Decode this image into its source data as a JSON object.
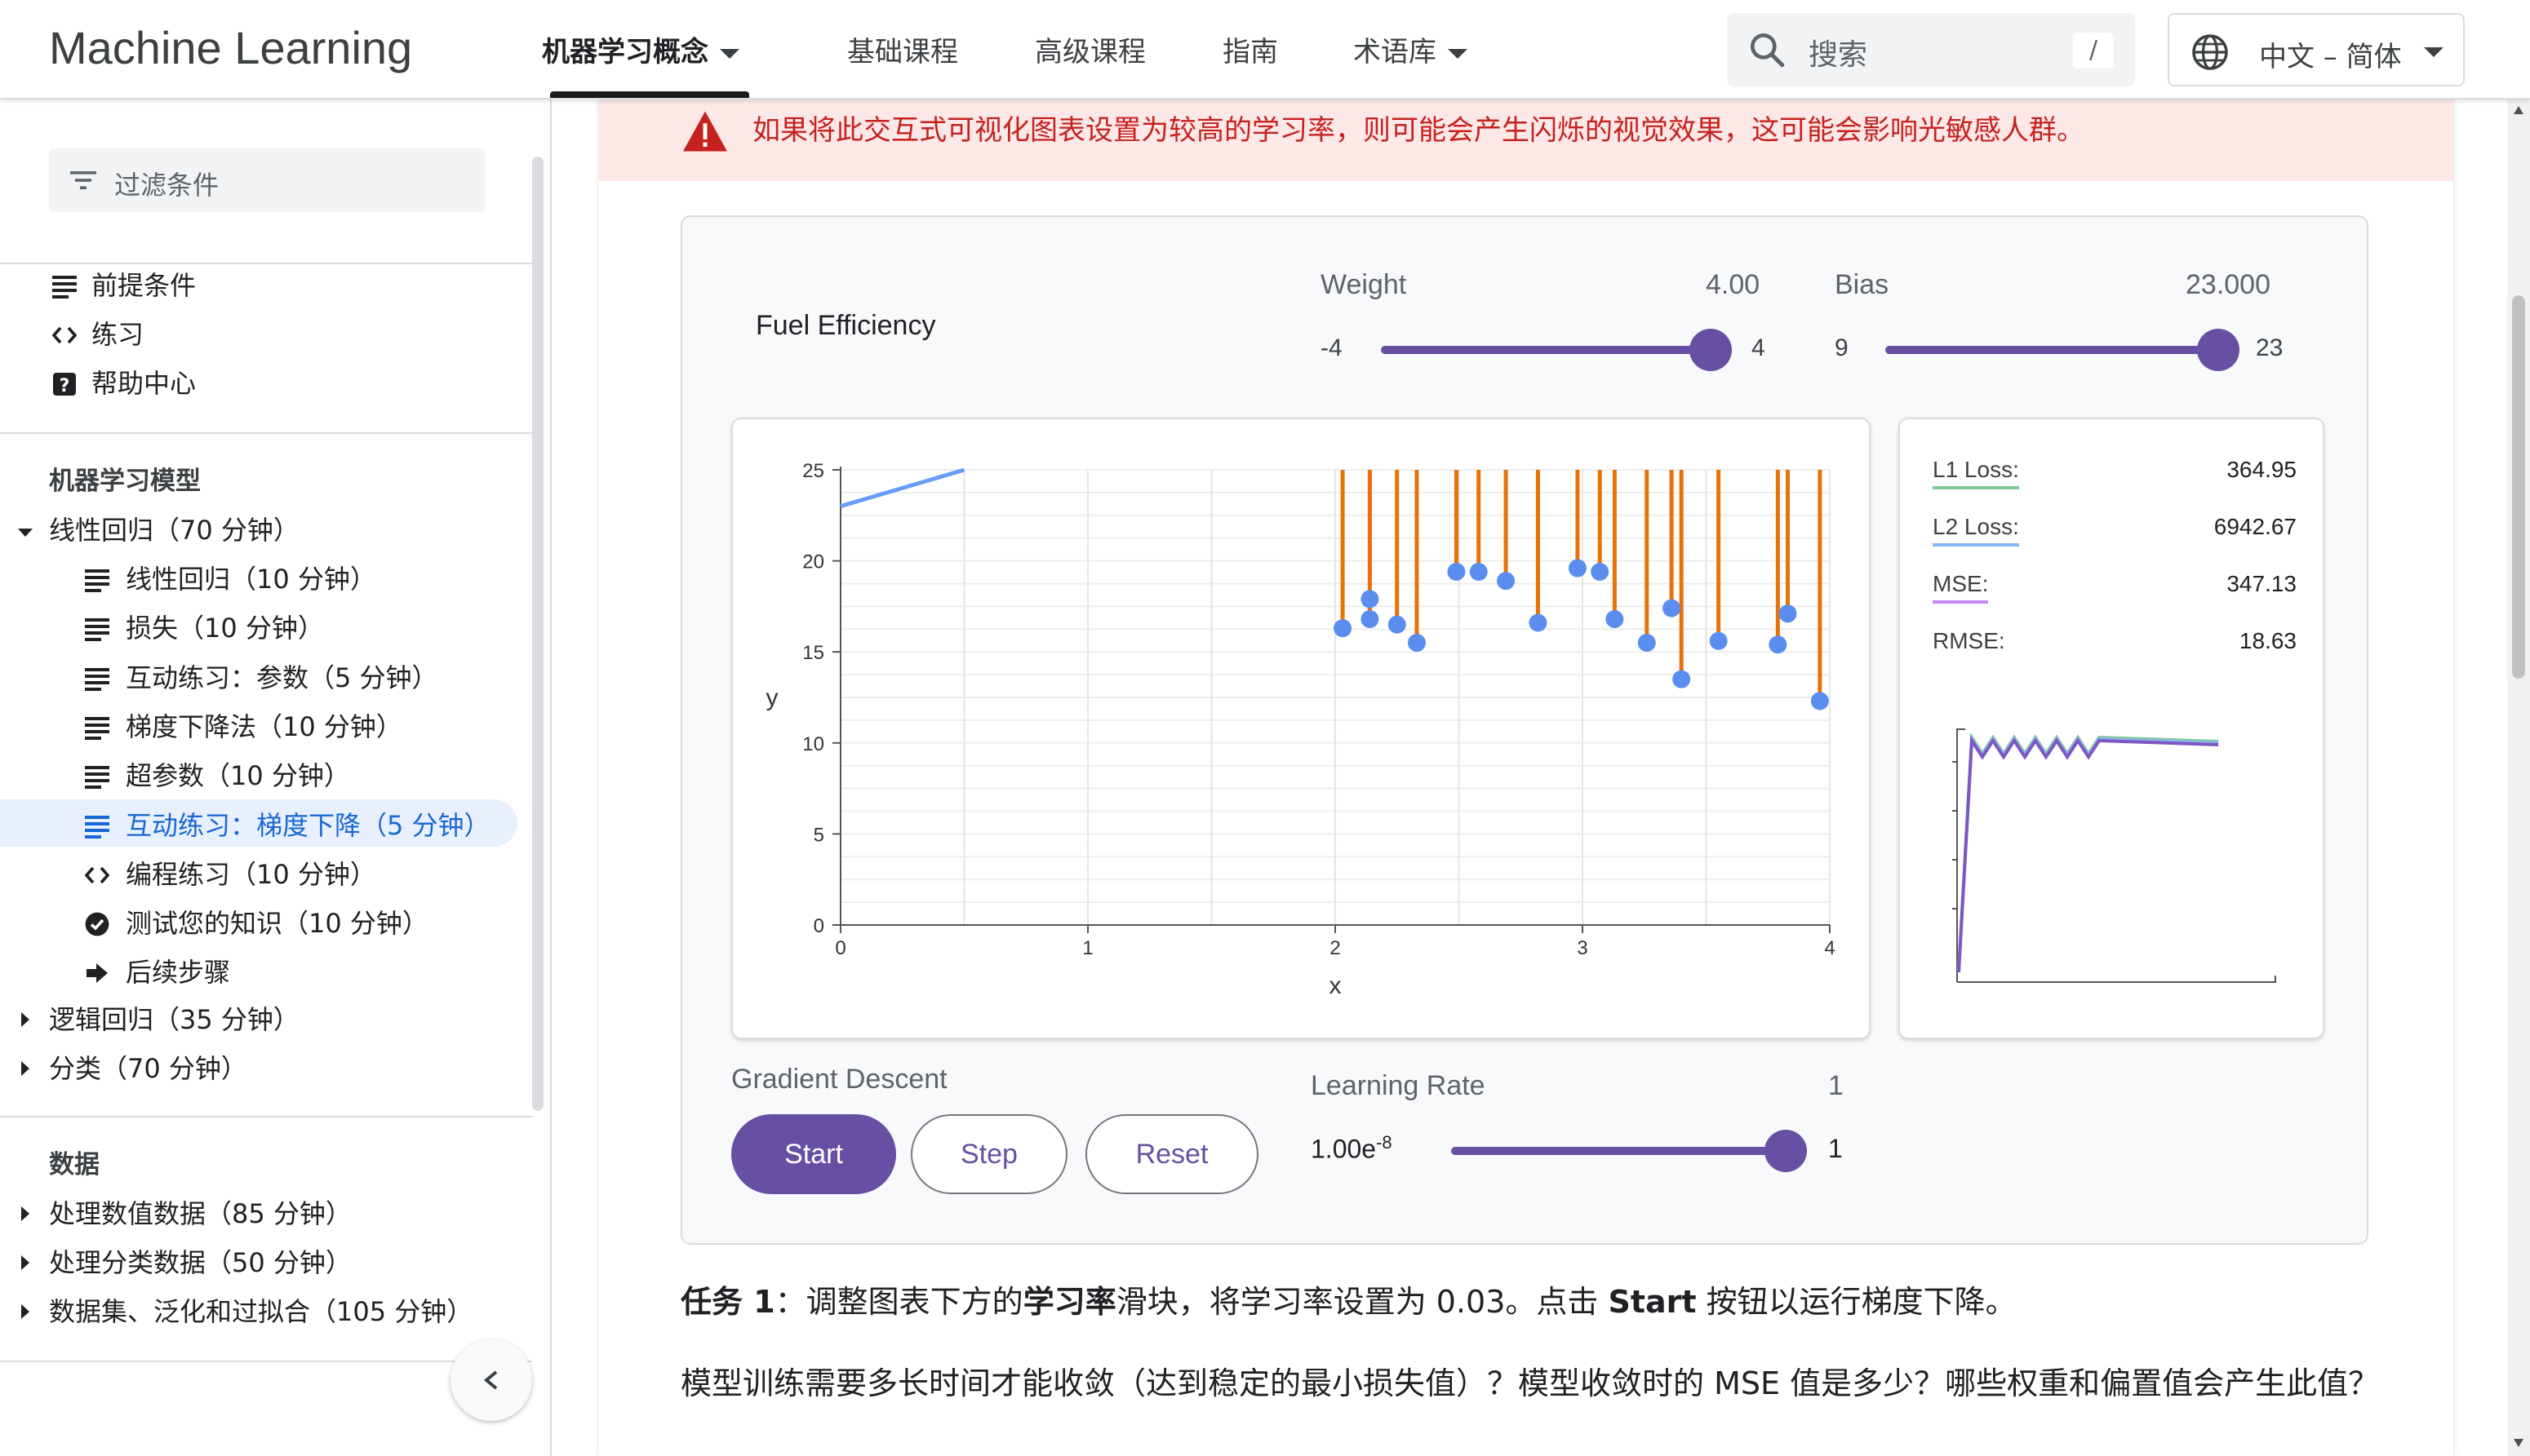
{
  "header": {
    "brand": "Machine Learning",
    "nav": [
      {
        "label": "机器学习概念",
        "active": true,
        "dropdown": true
      },
      {
        "label": "基础课程"
      },
      {
        "label": "高级课程"
      },
      {
        "label": "指南"
      },
      {
        "label": "术语库",
        "dropdown": true
      }
    ],
    "search_placeholder": "搜索",
    "search_shortcut": "/",
    "language": "中文 – 简体"
  },
  "sidebar": {
    "filter_placeholder": "过滤条件",
    "top_links": [
      {
        "label": "前提条件",
        "icon": "doc-lines-icon"
      },
      {
        "label": "练习",
        "icon": "code-icon"
      },
      {
        "label": "帮助中心",
        "icon": "help-icon"
      }
    ],
    "section1": "机器学习模型",
    "linear_regression": "线性回归（70 分钟）",
    "lr_children": [
      {
        "label": "线性回归（10 分钟）",
        "icon": "doc-lines-icon"
      },
      {
        "label": "损失（10 分钟）",
        "icon": "doc-lines-icon"
      },
      {
        "label": "互动练习：参数（5 分钟）",
        "icon": "doc-lines-icon"
      },
      {
        "label": "梯度下降法（10 分钟）",
        "icon": "doc-lines-icon"
      },
      {
        "label": "超参数（10 分钟）",
        "icon": "doc-lines-icon"
      },
      {
        "label": "互动练习：梯度下降（5 分钟）",
        "icon": "doc-lines-icon",
        "active": true
      },
      {
        "label": "编程练习（10 分钟）",
        "icon": "code-icon"
      },
      {
        "label": "测试您的知识（10 分钟）",
        "icon": "check-circle-icon"
      },
      {
        "label": "后续步骤",
        "icon": "arrow-right-icon"
      }
    ],
    "logistic_regression": "逻辑回归（35 分钟）",
    "classification": "分类（70 分钟）",
    "section2": "数据",
    "data_items": [
      "处理数值数据（85 分钟）",
      "处理分类数据（50 分钟）",
      "数据集、泛化和过拟合（105 分钟）"
    ]
  },
  "warning": "如果将此交互式可视化图表设置为较高的学习率，则可能会产生闪烁的视觉效果，这可能会影响光敏感人群。",
  "widget": {
    "title": "Fuel Efficiency",
    "weight": {
      "label": "Weight",
      "value": "4.00",
      "min": "-4",
      "max": "4",
      "level": 1.0
    },
    "bias": {
      "label": "Bias",
      "value": "23.000",
      "min": "9",
      "max": "23",
      "level": 1.0
    },
    "gradient_label": "Gradient Descent",
    "start": "Start",
    "step": "Step",
    "reset": "Reset",
    "lr": {
      "label": "Learning Rate",
      "value": "1",
      "min_base": "1.00e",
      "min_exp": "-8",
      "max": "1",
      "level": 1.0
    },
    "losses": [
      {
        "label": "L1 Loss:",
        "value": "364.95",
        "color": "#81c995"
      },
      {
        "label": "L2 Loss:",
        "value": "6942.67",
        "color": "#8ab4f8"
      },
      {
        "label": "MSE:",
        "value": "347.13",
        "color": "#c58af9"
      },
      {
        "label": "RMSE:",
        "value": "18.63",
        "color": ""
      }
    ]
  },
  "chart_data": {
    "type": "scatter",
    "xlabel": "x",
    "ylabel": "y",
    "xlim": [
      0,
      4
    ],
    "ylim": [
      0,
      25
    ],
    "xticks": [
      0,
      1,
      2,
      3,
      4
    ],
    "yticks": [
      0,
      5,
      10,
      15,
      20,
      25
    ],
    "model_line": {
      "weight": 4.0,
      "bias": 23.0,
      "color": "#669df6"
    },
    "points_color": "#5b8def",
    "residual_color": "#e8710a",
    "points": [
      [
        2.03,
        16.3
      ],
      [
        2.14,
        17.9
      ],
      [
        2.14,
        16.8
      ],
      [
        2.25,
        16.5
      ],
      [
        2.33,
        15.5
      ],
      [
        2.49,
        19.4
      ],
      [
        2.58,
        19.4
      ],
      [
        2.69,
        18.9
      ],
      [
        2.82,
        16.6
      ],
      [
        2.98,
        19.6
      ],
      [
        3.07,
        19.4
      ],
      [
        3.13,
        16.8
      ],
      [
        3.26,
        15.5
      ],
      [
        3.36,
        17.4
      ],
      [
        3.4,
        13.5
      ],
      [
        3.55,
        15.6
      ],
      [
        3.79,
        15.4
      ],
      [
        3.83,
        17.1
      ],
      [
        3.96,
        12.3
      ]
    ],
    "loss_curve": {
      "series": [
        {
          "name": "L1",
          "color": "#81c995"
        },
        {
          "name": "L2",
          "color": "#8ab4f8"
        },
        {
          "name": "MSE",
          "color": "#7e57c2"
        }
      ]
    }
  },
  "task": {
    "prefix": "任务 1",
    "t1": "：调整图表下方的",
    "bold1": "学习率",
    "t2": "滑块，将学习率设置为 0.03。点击 ",
    "bold2": "Start",
    "t3": " 按钮以运行梯度下降。"
  },
  "question": "模型训练需要多长时间才能收敛（达到稳定的最小损失值）？模型收敛时的 MSE 值是多少？哪些权重和偏置值会产生此值？"
}
